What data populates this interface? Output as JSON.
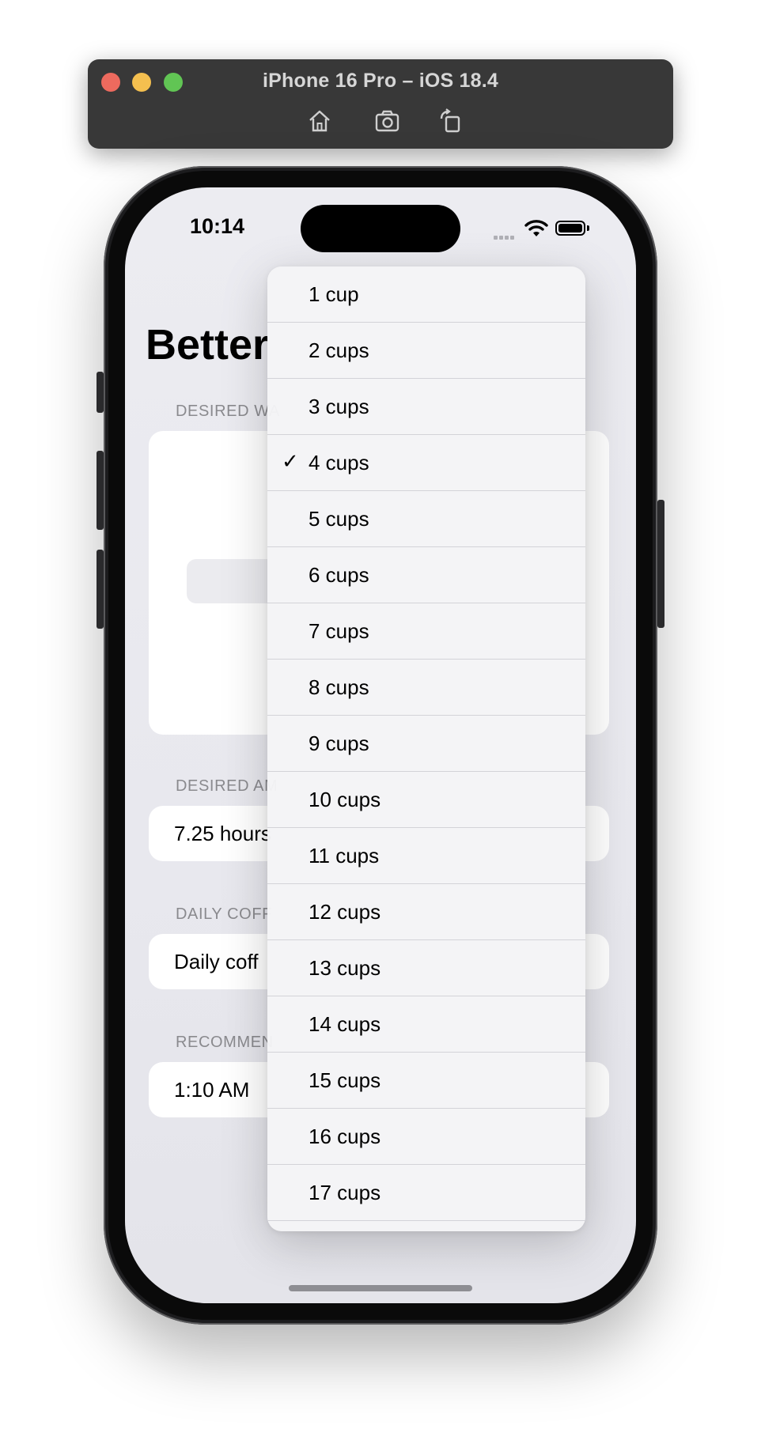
{
  "simulator": {
    "title": "iPhone 16 Pro – iOS 18.4",
    "toolbar": [
      "home-icon",
      "screenshot-icon",
      "rotate-icon"
    ]
  },
  "status_bar": {
    "time": "10:14"
  },
  "app": {
    "title": "Better",
    "sections": {
      "wake": {
        "header": "DESIRED WA"
      },
      "sleep": {
        "header": "DESIRED AM",
        "value": "7.25 hours"
      },
      "coffee": {
        "header": "DAILY COFF",
        "value": "Daily coff"
      },
      "recommended": {
        "header": "RECOMMEN",
        "value": "1:10 AM"
      }
    }
  },
  "menu": {
    "selected": "4 cups",
    "checkmark": "✓",
    "items": [
      "1 cup",
      "2 cups",
      "3 cups",
      "4 cups",
      "5 cups",
      "6 cups",
      "7 cups",
      "8 cups",
      "9 cups",
      "10 cups",
      "11 cups",
      "12 cups",
      "13 cups",
      "14 cups",
      "15 cups",
      "16 cups",
      "17 cups"
    ]
  }
}
